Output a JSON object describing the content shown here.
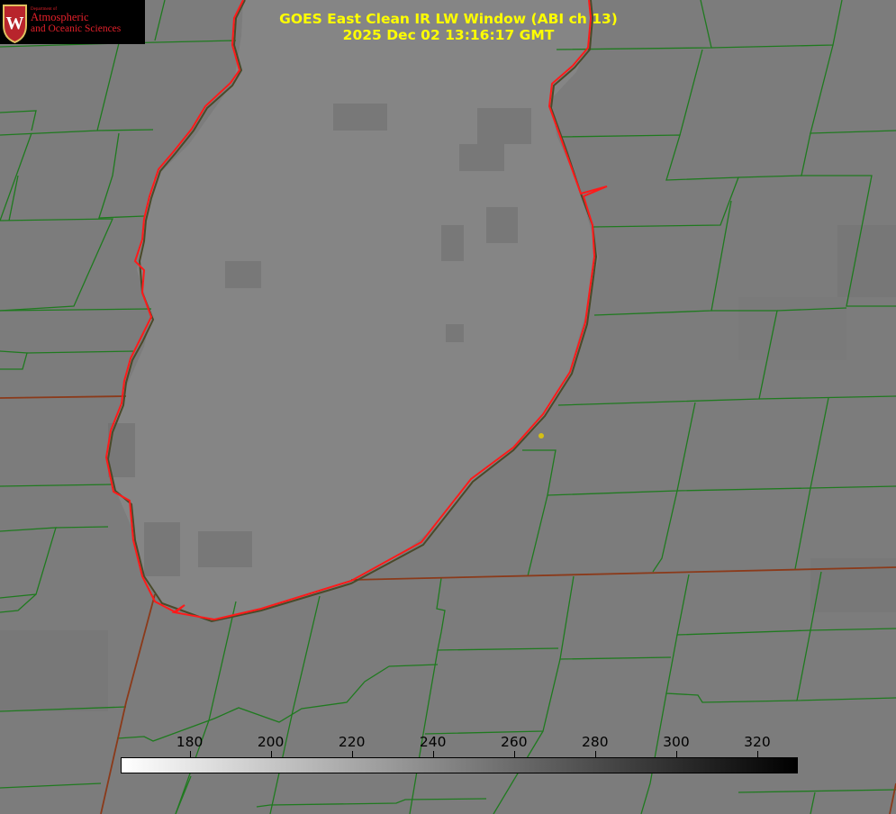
{
  "header": {
    "title_line1": "GOES East Clean IR LW Window (ABI ch 13)",
    "title_line2": "2025 Dec 02 13:16:17 GMT"
  },
  "logo": {
    "dept": "Department of",
    "line1": "Atmospheric",
    "line2": "and Oceanic Sciences",
    "shield_letter": "W"
  },
  "colorbar": {
    "unit_note": "",
    "min_value": 163,
    "max_value": 330,
    "gradient_from": "#ffffff",
    "gradient_to": "#000000",
    "ticks": [
      "180",
      "200",
      "220",
      "240",
      "260",
      "280",
      "300",
      "320"
    ]
  },
  "map": {
    "background_color": "#7c7c7c",
    "lake_color": "#858585",
    "county_line_color": "#1f7a1f",
    "state_line_color": "#8b3a1a",
    "coastline_color": "#ff1a1a",
    "marker_color": "#d4c015"
  }
}
